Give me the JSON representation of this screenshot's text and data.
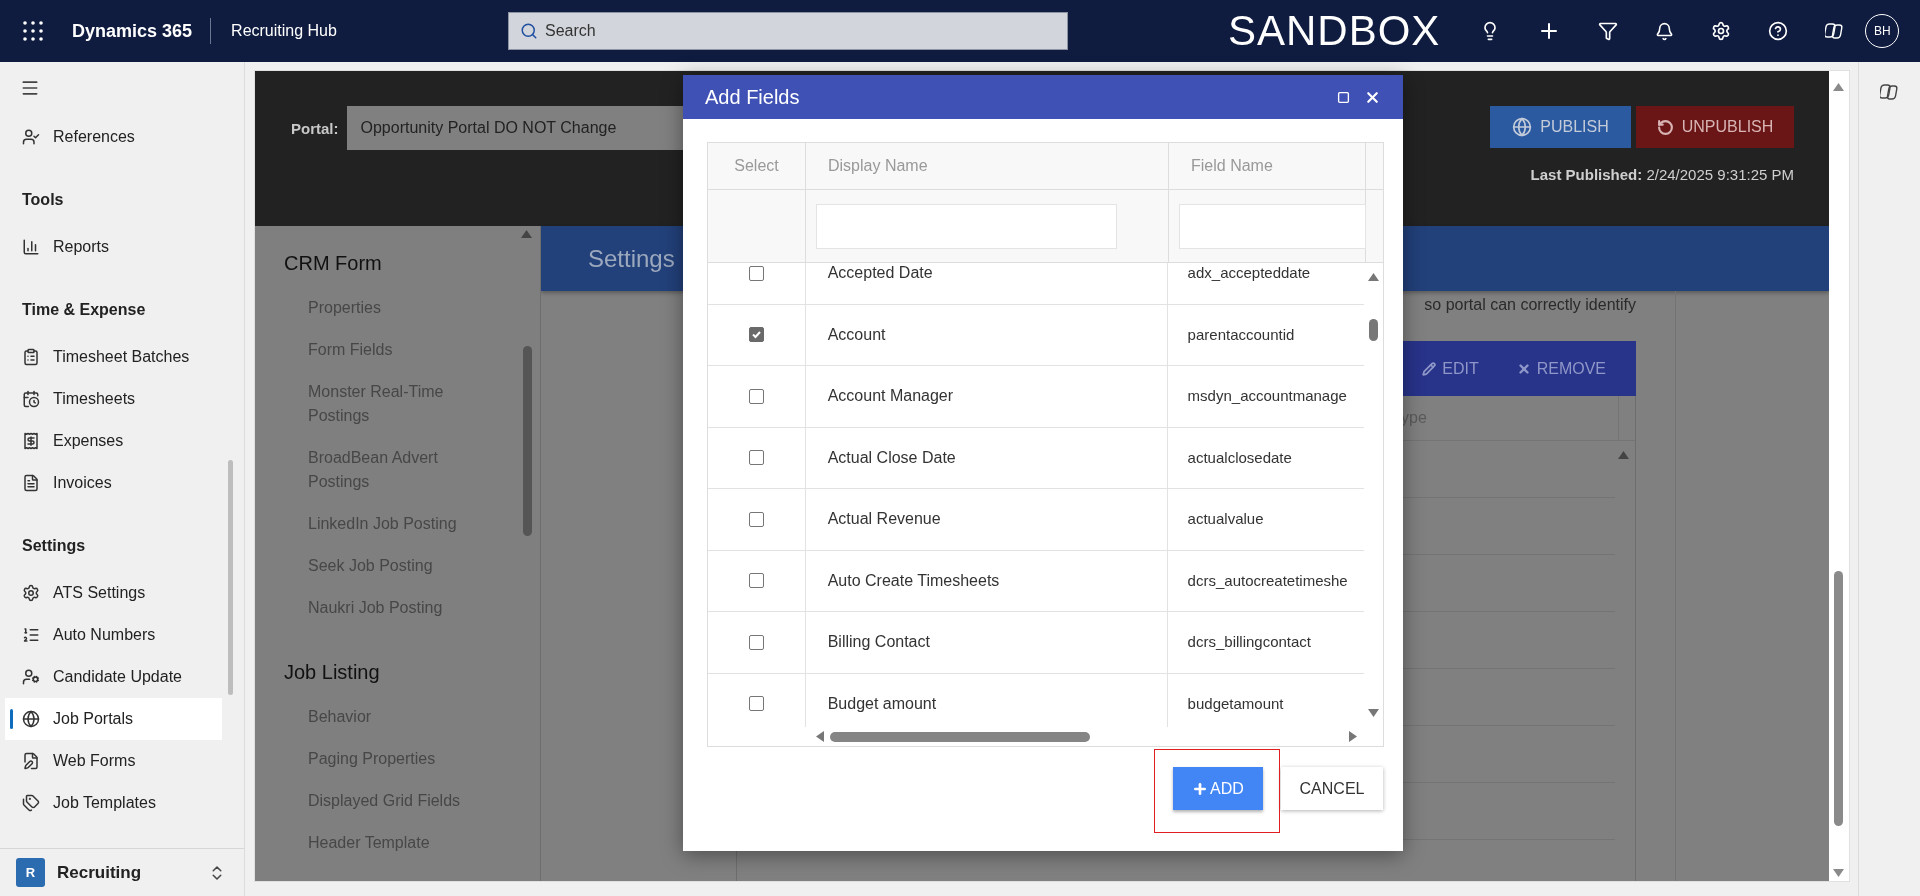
{
  "top_bar": {
    "app_name": "Dynamics 365",
    "area": "Recruiting Hub",
    "search_placeholder": "Search",
    "environment": "SANDBOX",
    "avatar": "BH"
  },
  "sidebar": {
    "items": [
      {
        "kind": "item",
        "label": "References",
        "selected": false
      },
      {
        "kind": "heading",
        "label": "Tools"
      },
      {
        "kind": "item",
        "label": "Reports",
        "selected": false
      },
      {
        "kind": "heading",
        "label": "Time & Expense"
      },
      {
        "kind": "item",
        "label": "Timesheet Batches",
        "selected": false
      },
      {
        "kind": "item",
        "label": "Timesheets",
        "selected": false
      },
      {
        "kind": "item",
        "label": "Expenses",
        "selected": false
      },
      {
        "kind": "item",
        "label": "Invoices",
        "selected": false
      },
      {
        "kind": "heading",
        "label": "Settings"
      },
      {
        "kind": "item",
        "label": "ATS Settings",
        "selected": false
      },
      {
        "kind": "item",
        "label": "Auto Numbers",
        "selected": false
      },
      {
        "kind": "item",
        "label": "Candidate Update",
        "selected": false
      },
      {
        "kind": "item",
        "label": "Job Portals",
        "selected": true
      },
      {
        "kind": "item",
        "label": "Web Forms",
        "selected": false
      },
      {
        "kind": "item",
        "label": "Job Templates",
        "selected": false
      }
    ],
    "area_switcher": {
      "badge": "R",
      "label": "Recruiting"
    }
  },
  "portal": {
    "label": "Portal:",
    "value": "Opportunity Portal DO NOT Change",
    "publish": "PUBLISH",
    "unpublish": "UNPUBLISH",
    "last_published_label": "Last Published:",
    "last_published": "2/24/2025 9:31:25 PM"
  },
  "settings_nav": {
    "sections": [
      {
        "title": "CRM Form",
        "items": [
          "Properties",
          "Form Fields",
          "Monster Real-Time Postings",
          "BroadBean Advert Postings",
          "LinkedIn Job Posting",
          "Seek Job Posting",
          "Naukri Job Posting"
        ]
      },
      {
        "title": "Job Listing",
        "items": [
          "Behavior",
          "Paging Properties",
          "Displayed Grid Fields",
          "Header Template"
        ]
      }
    ]
  },
  "settings_header": "Settings",
  "content": {
    "note": "so portal can correctly identify",
    "toolbar": [
      "EDIT",
      "REMOVE"
    ],
    "grid_header": "ype"
  },
  "dialog": {
    "title": "Add Fields",
    "columns": [
      "Select",
      "Display Name",
      "Field Name"
    ],
    "rows": [
      {
        "display_name": "Accepted Date",
        "field_name": "adx_accepteddate",
        "checked": false
      },
      {
        "display_name": "Account",
        "field_name": "parentaccountid",
        "checked": true
      },
      {
        "display_name": "Account Manager",
        "field_name": "msdyn_accountmanage",
        "checked": false
      },
      {
        "display_name": "Actual Close Date",
        "field_name": "actualclosedate",
        "checked": false
      },
      {
        "display_name": "Actual Revenue",
        "field_name": "actualvalue",
        "checked": false
      },
      {
        "display_name": "Auto Create Timesheets",
        "field_name": "dcrs_autocreatetimeshe",
        "checked": false
      },
      {
        "display_name": "Billing Contact",
        "field_name": "dcrs_billingcontact",
        "checked": false
      },
      {
        "display_name": "Budget amount",
        "field_name": "budgetamount",
        "checked": false
      }
    ],
    "add": "ADD",
    "cancel": "CANCEL"
  }
}
